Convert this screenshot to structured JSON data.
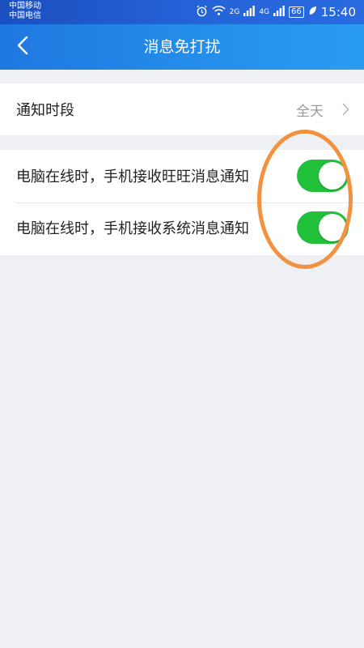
{
  "statusbar": {
    "carrier1": "中国移动",
    "carrier2": "中国电信",
    "net1": "2G",
    "net2": "4G",
    "battery": "66",
    "time": "15:40"
  },
  "navbar": {
    "title": "消息免打扰"
  },
  "settings": {
    "notify_period": {
      "label": "通知时段",
      "value": "全天"
    },
    "toggles": [
      {
        "label": "电脑在线时，手机接收旺旺消息通知",
        "on": true
      },
      {
        "label": "电脑在线时，手机接收系统消息通知",
        "on": true
      }
    ]
  },
  "colors": {
    "nav_gradient": [
      "#1f77e0",
      "#2a9cf0"
    ],
    "toggle_on": "#22c13a",
    "annotation": "#f2913f",
    "background": "#eff0f4"
  },
  "icons": [
    "back-arrow-icon",
    "alarm-icon",
    "wifi-icon",
    "signal-icon",
    "battery-icon",
    "leaf-icon",
    "chevron-right-icon"
  ]
}
